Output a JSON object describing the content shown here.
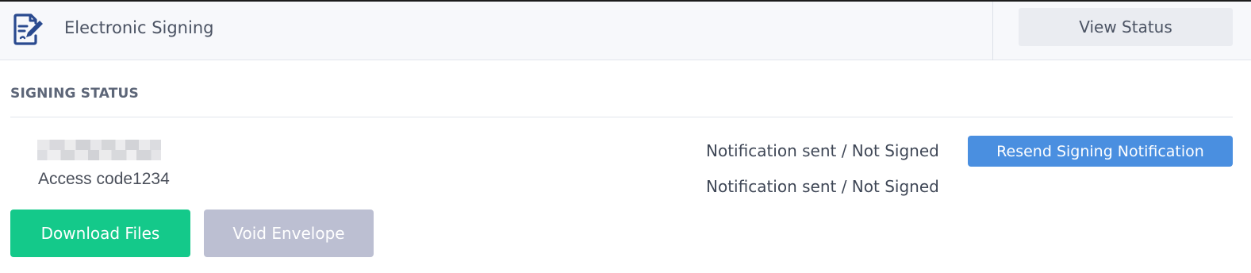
{
  "header": {
    "title": "Electronic Signing",
    "icon": "document-sign-icon",
    "view_status_label": "View Status"
  },
  "section": {
    "title": "SIGNING STATUS"
  },
  "signer": {
    "name_redacted": true,
    "access_code_label": "Access code",
    "access_code": "1234",
    "access_code_text": "Access code1234"
  },
  "statuses": [
    {
      "text": "Notification sent / Not Signed"
    },
    {
      "text": "Notification sent / Not Signed"
    }
  ],
  "actions": {
    "resend_label": "Resend Signing Notification",
    "download_label": "Download Files",
    "void_label": "Void Envelope"
  },
  "colors": {
    "header_bg": "#f7f8fb",
    "icon_color": "#2a4a8f",
    "primary_blue": "#4a8fe0",
    "success_green": "#14c98a",
    "disabled_gray": "#bcbfd2",
    "text_dark": "#3f4756"
  }
}
